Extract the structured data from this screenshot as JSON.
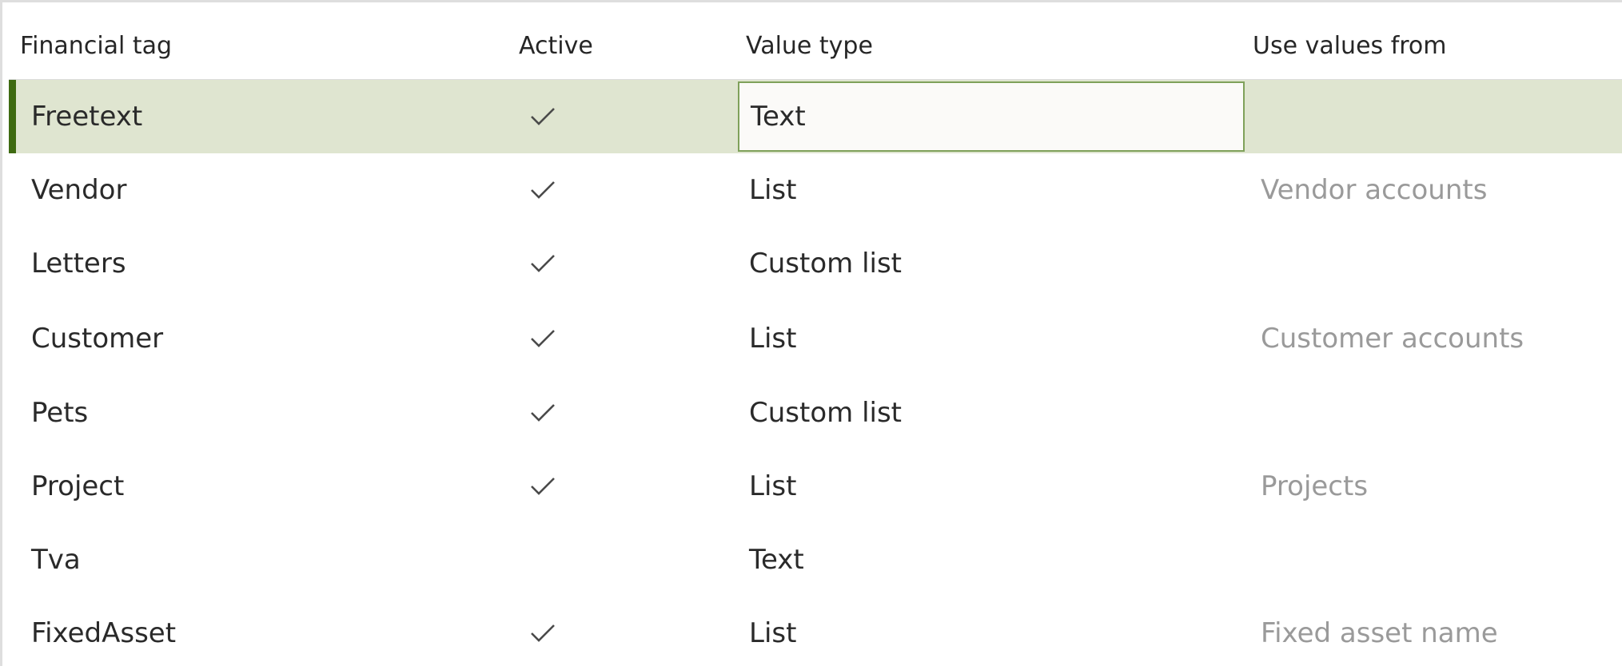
{
  "columns": {
    "financial_tag": "Financial tag",
    "active": "Active",
    "value_type": "Value type",
    "use_values_from": "Use values from"
  },
  "icons": {
    "active_check": "checkmark-icon"
  },
  "colors": {
    "selected_row_bg": "#dfe5d0",
    "selected_row_marker": "#3e6a11",
    "edit_border": "#7fa15a",
    "muted_text": "#9a9a9a"
  },
  "rows": [
    {
      "financial_tag": "Freetext",
      "active": true,
      "value_type": "Text",
      "use_values_from": "",
      "selected": true
    },
    {
      "financial_tag": "Vendor",
      "active": true,
      "value_type": "List",
      "use_values_from": "Vendor accounts"
    },
    {
      "financial_tag": "Letters",
      "active": true,
      "value_type": "Custom list",
      "use_values_from": ""
    },
    {
      "financial_tag": "Customer",
      "active": true,
      "value_type": "List",
      "use_values_from": "Customer accounts"
    },
    {
      "financial_tag": "Pets",
      "active": true,
      "value_type": "Custom list",
      "use_values_from": ""
    },
    {
      "financial_tag": "Project",
      "active": true,
      "value_type": "List",
      "use_values_from": "Projects"
    },
    {
      "financial_tag": "Tva",
      "active": false,
      "value_type": "Text",
      "use_values_from": ""
    },
    {
      "financial_tag": "FixedAsset",
      "active": true,
      "value_type": "List",
      "use_values_from": "Fixed asset name"
    }
  ]
}
